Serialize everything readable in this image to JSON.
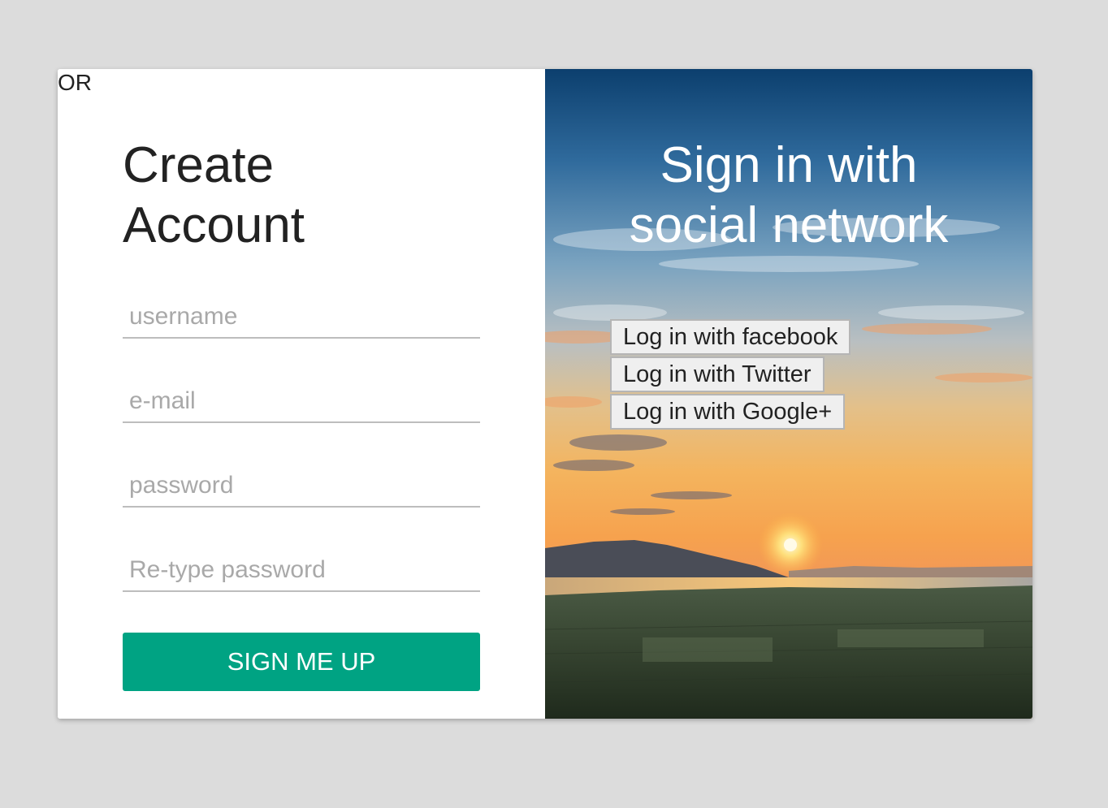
{
  "divider": {
    "or_label": "OR"
  },
  "signup": {
    "title": "Create\nAccount",
    "fields": {
      "username_placeholder": "username",
      "email_placeholder": "e-mail",
      "password_placeholder": "password",
      "retype_placeholder": "Re-type password"
    },
    "submit_label": "SIGN ME UP"
  },
  "social": {
    "title": "Sign in with\nsocial network",
    "facebook_label": "Log in with facebook",
    "twitter_label": "Log in with Twitter",
    "google_label": "Log in with Google+"
  },
  "colors": {
    "accent": "#00a383",
    "background": "#dcdcdc"
  }
}
